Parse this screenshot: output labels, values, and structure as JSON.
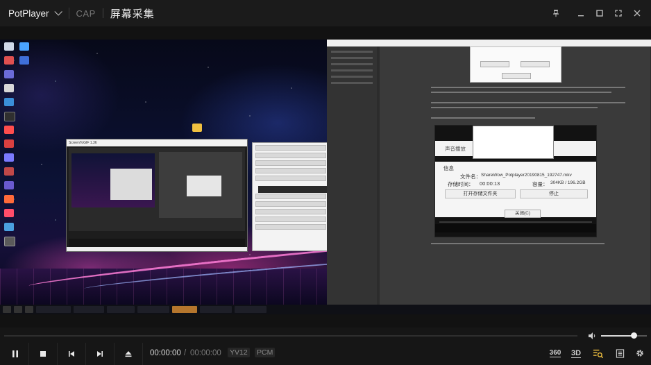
{
  "app": {
    "name": "PotPlayer",
    "mode": "CAP",
    "window_title": "屏幕采集"
  },
  "window_buttons": [
    "pin-icon",
    "minimize-icon",
    "maximize-icon",
    "fullscreen-icon",
    "close-icon"
  ],
  "video": {
    "inner_window_title": "ScreenToGIF 1.36",
    "inner_player_title": "声音播放",
    "inner_player_panel": {
      "label_file": "文件名：",
      "file_name": "ShareWow_Potplayer20190815_192747.mkv",
      "label_time": "存储时间：",
      "time_value": "00:00:13",
      "label_size": "容量：",
      "size_value": "304KB / 196.2GB",
      "section": "信息",
      "open_folder_button": "打开存储文件夹",
      "stop_button": "停止",
      "close_button": "关闭(C)"
    }
  },
  "controls": {
    "current_time": "00:00:00",
    "separator": "/",
    "total_time": "00:00:00",
    "video_format": "YV12",
    "audio_format": "PCM",
    "volume_fraction": 0.75,
    "right_icons": [
      "360",
      "3D"
    ]
  },
  "colors": {
    "accent": "#f0f0f0",
    "background": "#121212",
    "ribbon": "#ff7ed8"
  }
}
